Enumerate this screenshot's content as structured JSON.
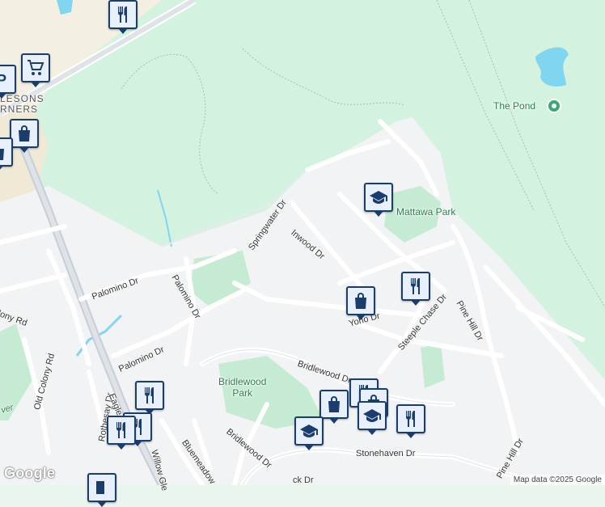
{
  "map": {
    "labels": {
      "tysons": "LESONS\nRNERS",
      "the_pond": "The Pond",
      "mattawa_park": "Mattawa Park",
      "bridlewood_park": "Bridlewood\nPark",
      "springwater_dr": "Springwater Dr",
      "inwood_dr": "Inwood Dr",
      "palomino_dr_1": "Palomino Dr",
      "palomino_dr_2": "Palomino Dr",
      "palomino_dr_3": "Palomino Dr",
      "yoho_dr": "Yoho Dr",
      "steeple_chase_dr": "Steeple Chase Dr",
      "pine_hill_dr_1": "Pine Hill Dr",
      "pine_hill_dr_2": "Pine Hill Dr",
      "bridlewood_dr_1": "Bridlewood Dr",
      "bridlewood_dr_2": "Bridlewood Dr",
      "stonehaven_dr": "Stonehaven Dr",
      "old_colony_rd_1": "lony Rd",
      "old_colony_rd_2": "Old Colony Rd",
      "rothesay_dr": "Rothesay Dr",
      "eagleson_rd": "Eagle",
      "bluemeadow": "Bluemeadow",
      "willow_glen": "Willow Gle",
      "stonehaven_trail": "ck Dr",
      "waterway": "ver"
    },
    "attribution": "Map data ©2025 Google",
    "logo": "Google",
    "colors": {
      "forest": "#d3f3e0",
      "residential": "#f1f3f4",
      "park": "#c5ecd3",
      "commercial": "#f3efe2",
      "road": "#ffffff",
      "highway": "#c6ced8",
      "water": "#7fd6ee",
      "pin_border": "#1a3d6b",
      "pin_bg": "#e8f0fe"
    },
    "pins": [
      {
        "icon": "restaurant-icon"
      },
      {
        "icon": "shopping-cart-icon"
      },
      {
        "icon": "parking-icon"
      },
      {
        "icon": "shopping-bag-icon"
      },
      {
        "icon": "school-icon"
      },
      {
        "icon": "shopping-bag-icon"
      },
      {
        "icon": "restaurant-icon"
      },
      {
        "icon": "restaurant-icon"
      },
      {
        "icon": "restaurant-icon"
      },
      {
        "icon": "restaurant-icon"
      },
      {
        "icon": "shopping-bag-icon"
      },
      {
        "icon": "school-icon"
      },
      {
        "icon": "school-icon"
      },
      {
        "icon": "restaurant-icon"
      },
      {
        "icon": "gas-station-icon"
      }
    ]
  }
}
